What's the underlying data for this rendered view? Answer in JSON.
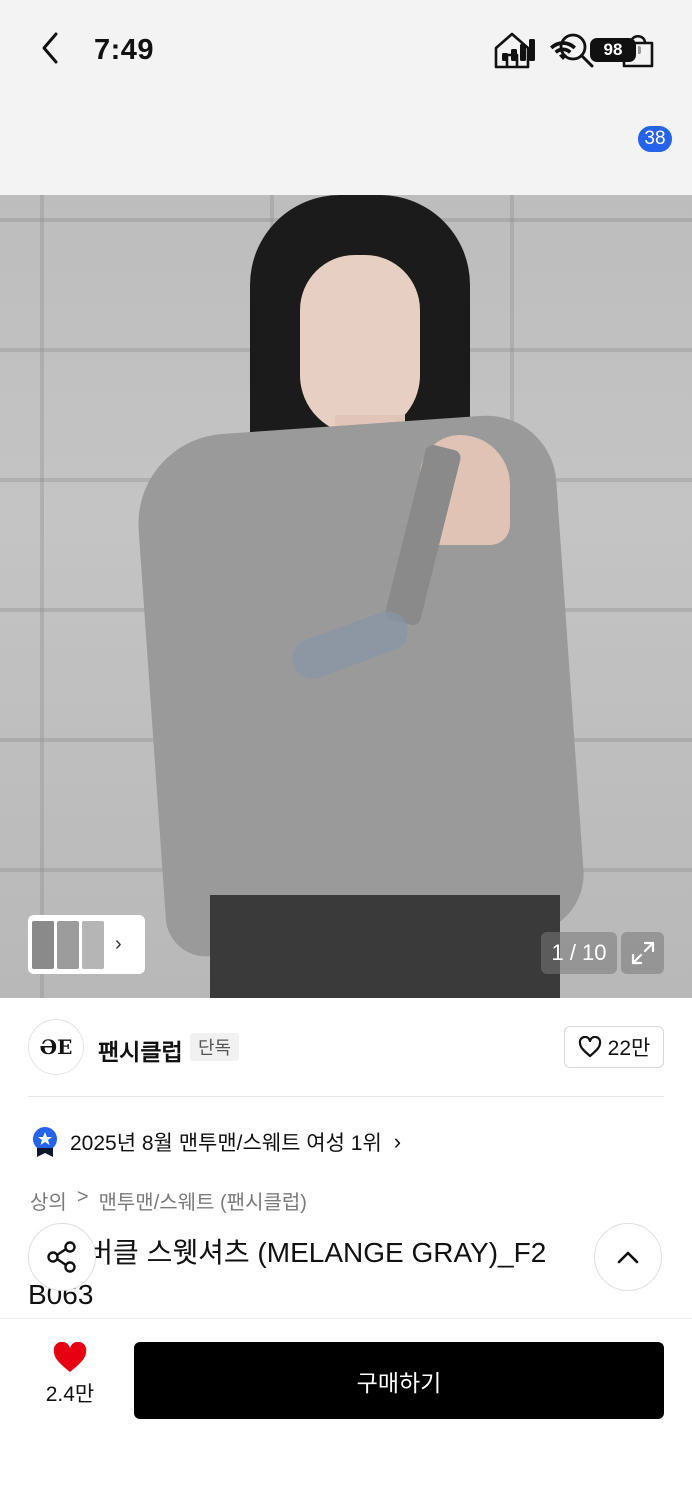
{
  "status_bar": {
    "time": "7:49",
    "battery": "98"
  },
  "nav": {
    "cart_count": "38"
  },
  "gallery": {
    "counter": "1 / 10"
  },
  "brand": {
    "logo_text": "ƏE",
    "name": "팬시클럽",
    "tag": "단독",
    "likes": "22만"
  },
  "ranking": {
    "text": "2025년 8월 맨투맨/스웨트 여성 1위"
  },
  "category": {
    "level1": "상의",
    "separator": ">",
    "level2": "맨투맨/스웨트 (팬시클럽)"
  },
  "product": {
    "title": "숄더 버클 스웻셔츠 (MELANGE GRAY)_F2 B063"
  },
  "bottom": {
    "wish_count": "2.4만",
    "buy_label": "구매하기"
  },
  "colors": {
    "badge": "#2563eb",
    "heart": "#e60012",
    "buy_button": "#000000"
  }
}
